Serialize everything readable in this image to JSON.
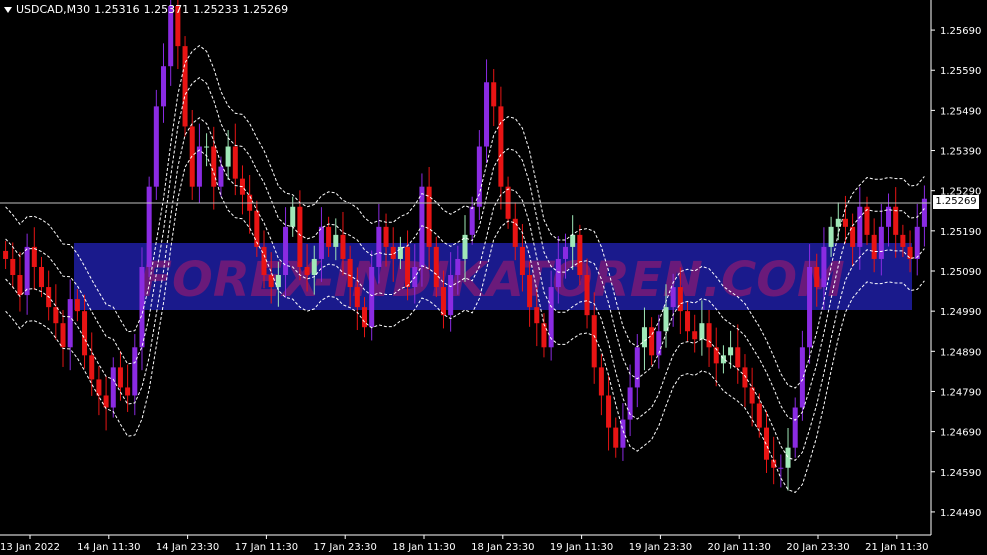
{
  "header": {
    "symbol": "USDCAD,M30",
    "open": "1.25316",
    "high": "1.25371",
    "low": "1.25233",
    "close": "1.25269"
  },
  "current_price": "1.25269",
  "watermark": "FOREX-INDIKATOREN.COM",
  "colors": {
    "background": "#000000",
    "axis": "#ffffff",
    "bull": "#a0e8b8",
    "bear": "#e81414",
    "strong_up": "#8a2be2",
    "strong_down": "#6010c0",
    "band": "#ffffff",
    "watermark_bg": "#1a1a8c",
    "watermark_text": "#6a1a7a"
  },
  "y_axis": {
    "labels": [
      "1.25690",
      "1.25590",
      "1.25490",
      "1.25390",
      "1.25290",
      "1.25190",
      "1.25090",
      "1.24990",
      "1.24890",
      "1.24790",
      "1.24690",
      "1.24590",
      "1.24490"
    ],
    "min": 1.2444,
    "max": 1.2574
  },
  "x_axis": {
    "labels": [
      "13 Jan 2022",
      "14 Jan 11:30",
      "14 Jan 23:30",
      "17 Jan 11:30",
      "17 Jan 23:30",
      "18 Jan 11:30",
      "18 Jan 23:30",
      "19 Jan 11:30",
      "19 Jan 23:30",
      "20 Jan 11:30",
      "20 Jan 23:30",
      "21 Jan 11:30"
    ]
  },
  "chart_data": {
    "type": "candlestick",
    "series_close": [
      1.2512,
      1.2508,
      1.2503,
      1.2515,
      1.251,
      1.2505,
      1.25,
      1.2496,
      1.249,
      1.2502,
      1.2499,
      1.2488,
      1.2482,
      1.2478,
      1.2475,
      1.2485,
      1.248,
      1.2478,
      1.249,
      1.251,
      1.253,
      1.255,
      1.256,
      1.2575,
      1.2565,
      1.2545,
      1.253,
      1.254,
      1.254,
      1.253,
      1.2535,
      1.254,
      1.2532,
      1.2528,
      1.2524,
      1.2515,
      1.2508,
      1.2505,
      1.2508,
      1.252,
      1.2525,
      1.251,
      1.2508,
      1.2512,
      1.252,
      1.2515,
      1.2518,
      1.2512,
      1.2505,
      1.25,
      1.2495,
      1.251,
      1.252,
      1.2515,
      1.2512,
      1.2515,
      1.2505,
      1.251,
      1.253,
      1.2515,
      1.2505,
      1.2498,
      1.2508,
      1.2512,
      1.2518,
      1.2525,
      1.254,
      1.2556,
      1.255,
      1.253,
      1.2522,
      1.2515,
      1.2508,
      1.25,
      1.2496,
      1.249,
      1.2505,
      1.2512,
      1.2515,
      1.2518,
      1.2508,
      1.2498,
      1.2485,
      1.2478,
      1.247,
      1.2465,
      1.2472,
      1.248,
      1.249,
      1.2495,
      1.2488,
      1.2494,
      1.25,
      1.2505,
      1.2499,
      1.2494,
      1.2492,
      1.2496,
      1.249,
      1.2486,
      1.2488,
      1.249,
      1.2485,
      1.248,
      1.2476,
      1.247,
      1.2462,
      1.246,
      1.246,
      1.2465,
      1.2475,
      1.249,
      1.251,
      1.2505,
      1.2515,
      1.252,
      1.2522,
      1.252,
      1.2515,
      1.2525,
      1.2518,
      1.2512,
      1.252,
      1.2525,
      1.2518,
      1.2515,
      1.2512,
      1.252,
      1.2527
    ]
  }
}
